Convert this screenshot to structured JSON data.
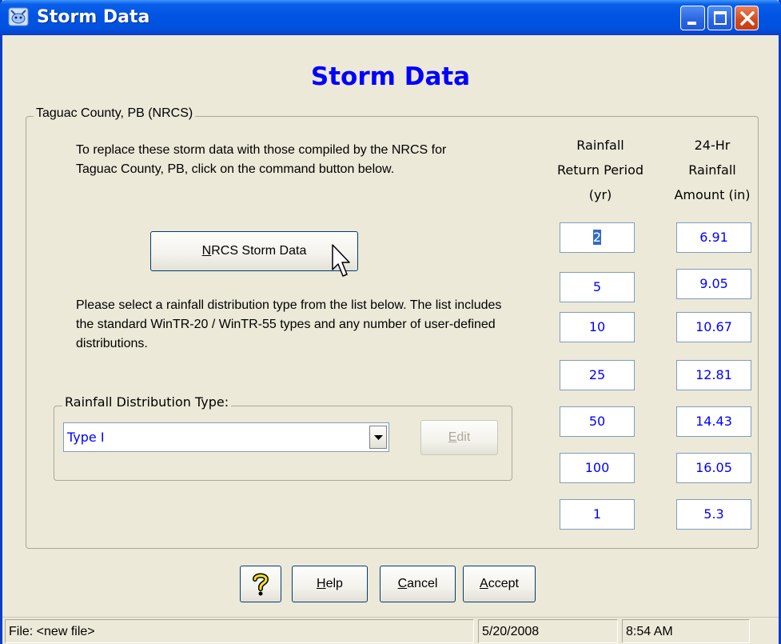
{
  "window": {
    "title": "Storm Data",
    "heading": "Storm Data"
  },
  "county_group": {
    "caption": "Taguac County, PB  (NRCS)",
    "instructions": "To replace these storm data with those compiled by the NRCS for Taguac County, PB, click on the command button below.",
    "nrcs_button": {
      "mnemonic": "N",
      "rest": "RCS Storm Data"
    },
    "distribution_instructions": "Please select a rainfall distribution type from the list below. The list includes the standard WinTR-20 / WinTR-55 types and any number of user-defined distributions."
  },
  "distribution": {
    "caption": "Rainfall Distribution Type:",
    "selected": "Type I",
    "edit_button": {
      "mnemonic": "E",
      "rest": "dit"
    }
  },
  "table": {
    "col1_header": [
      "Rainfall",
      "Return Period",
      "(yr)"
    ],
    "col2_header": [
      "24-Hr",
      "Rainfall",
      "Amount (in)"
    ],
    "rows": [
      {
        "period": "2",
        "amount": "6.91"
      },
      {
        "period": "5",
        "amount": "9.05"
      },
      {
        "period": "10",
        "amount": "10.67"
      },
      {
        "period": "25",
        "amount": "12.81"
      },
      {
        "period": "50",
        "amount": "14.43"
      },
      {
        "period": "100",
        "amount": "16.05"
      },
      {
        "period": "1",
        "amount": "5.3"
      }
    ]
  },
  "buttons": {
    "help": {
      "mnemonic": "H",
      "rest": "elp"
    },
    "cancel": {
      "mnemonic": "C",
      "rest": "ancel"
    },
    "accept": {
      "mnemonic": "A",
      "rest": "ccept"
    }
  },
  "status": {
    "file": "File: <new file>",
    "date": "5/20/2008",
    "time": "8:54 AM"
  },
  "colors": {
    "titlebar": "#0054e3",
    "heading": "#0000ff",
    "values": "#0000ff",
    "face": "#ece9d8"
  }
}
